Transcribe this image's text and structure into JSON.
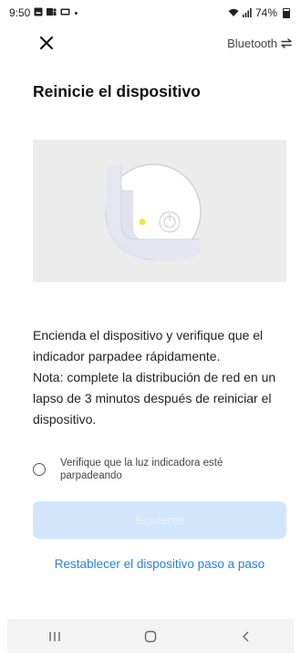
{
  "status_bar": {
    "time": "9:50",
    "notification_icons": [
      "gallery-icon",
      "teams-icon",
      "app-icon",
      "dot-icon"
    ],
    "battery_percent": "74%",
    "signal_icons": [
      "wifi-icon",
      "signal-icon"
    ]
  },
  "header": {
    "close_icon": "close-icon",
    "connection_label": "Bluetooth",
    "switch_icon": "swap-arrows-icon"
  },
  "title": "Reinicie el dispositivo",
  "illustration": {
    "description_icon": "device-power-indicator",
    "indicator_color": "#f5e23c"
  },
  "instructions": {
    "line1": "Encienda el dispositivo y verifique que el indicador parpadee rápidamente.",
    "line2": "Nota: complete la distribución de red en un lapso de 3 minutos después de reiniciar el dispositivo."
  },
  "confirm": {
    "label": "Verifique que la luz indicadora esté parpadeando",
    "checked": false
  },
  "next_button": {
    "label": "Siguiente",
    "enabled": false,
    "color": "#d1e6fb"
  },
  "reset_link": "Restablecer el dispositivo paso a paso",
  "nav_bar": {
    "items": [
      "recent-apps-icon",
      "home-icon",
      "back-icon"
    ]
  },
  "colors": {
    "accent": "#2b7de0",
    "illustration_bg": "#ececec"
  }
}
